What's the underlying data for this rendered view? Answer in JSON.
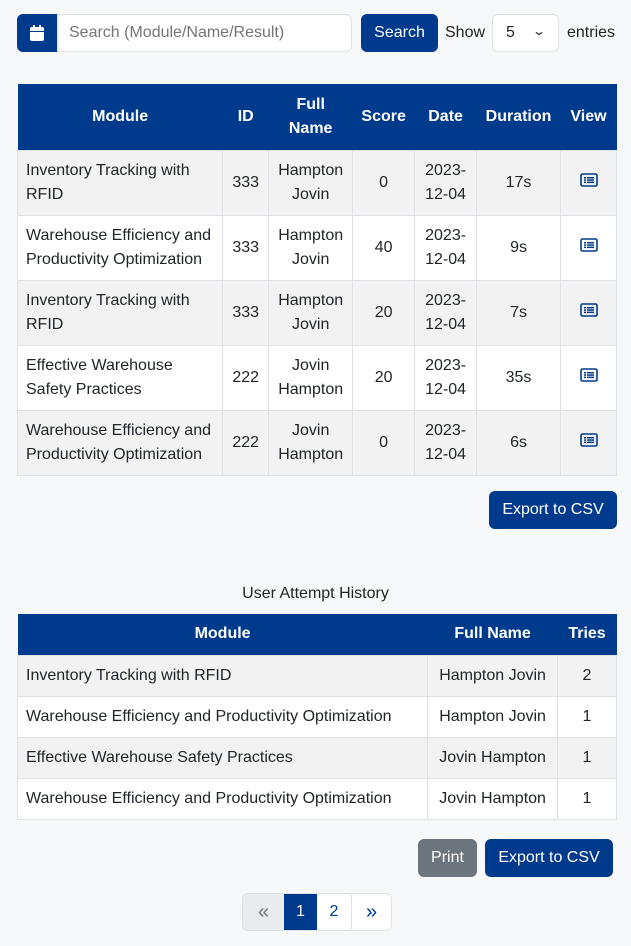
{
  "toolbar": {
    "search_placeholder": "Search (Module/Name/Result)",
    "search_label": "Search",
    "show_label": "Show",
    "entries_value": "5",
    "entries_label": "entries"
  },
  "results_table": {
    "headers": [
      "Module",
      "ID",
      "Full Name",
      "Score",
      "Date",
      "Duration",
      "View"
    ],
    "rows": [
      {
        "module": "Inventory Tracking with RFID",
        "id": "333",
        "name": "Hampton Jovin",
        "score": "0",
        "date": "2023-12-04",
        "duration": "17s"
      },
      {
        "module": "Warehouse Efficiency and Productivity Optimization",
        "id": "333",
        "name": "Hampton Jovin",
        "score": "40",
        "date": "2023-12-04",
        "duration": "9s"
      },
      {
        "module": "Inventory Tracking with RFID",
        "id": "333",
        "name": "Hampton Jovin",
        "score": "20",
        "date": "2023-12-04",
        "duration": "7s"
      },
      {
        "module": "Effective Warehouse Safety Practices",
        "id": "222",
        "name": "Jovin Hampton",
        "score": "20",
        "date": "2023-12-04",
        "duration": "35s"
      },
      {
        "module": "Warehouse Efficiency and Productivity Optimization",
        "id": "222",
        "name": "Jovin Hampton",
        "score": "0",
        "date": "2023-12-04",
        "duration": "6s"
      }
    ]
  },
  "export_label": "Export to CSV",
  "history": {
    "title": "User Attempt History",
    "headers": [
      "Module",
      "Full Name",
      "Tries"
    ],
    "rows": [
      {
        "module": "Inventory Tracking with RFID",
        "name": "Hampton Jovin",
        "tries": "2"
      },
      {
        "module": "Warehouse Efficiency and Productivity Optimization",
        "name": "Hampton Jovin",
        "tries": "1"
      },
      {
        "module": "Effective Warehouse Safety Practices",
        "name": "Jovin Hampton",
        "tries": "1"
      },
      {
        "module": "Warehouse Efficiency and Productivity Optimization",
        "name": "Jovin Hampton",
        "tries": "1"
      }
    ]
  },
  "print_label": "Print",
  "pagination": {
    "first": "«",
    "pages": [
      "1",
      "2"
    ],
    "current": "1",
    "last": "»"
  },
  "colors": {
    "primary": "#003a8c",
    "secondary": "#6c757d"
  }
}
